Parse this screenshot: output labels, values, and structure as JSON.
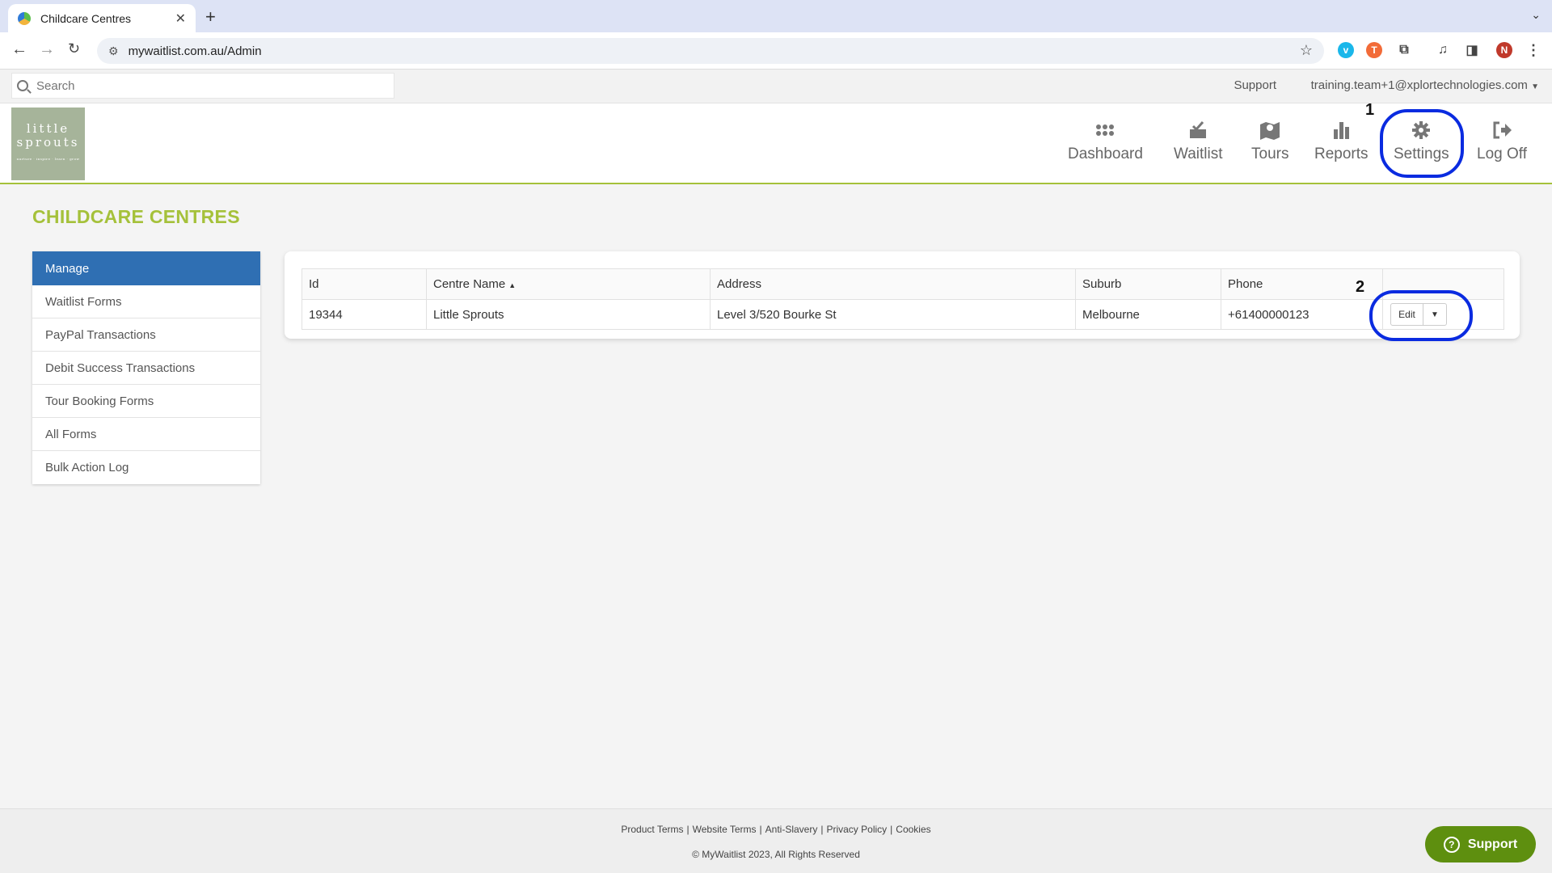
{
  "browser": {
    "tab_title": "Childcare Centres",
    "url": "mywaitlist.com.au/Admin",
    "profile_initial": "N"
  },
  "topbar": {
    "search_placeholder": "Search",
    "support_label": "Support",
    "user_email": "training.team+1@xplortechnologies.com"
  },
  "logo": {
    "line1": "little",
    "line2": "sprouts",
    "tagline": "nurture · inspire · learn · grow"
  },
  "nav": {
    "items": [
      {
        "label": "Dashboard",
        "icon": "grid-icon"
      },
      {
        "label": "Waitlist",
        "icon": "inbox-check-icon"
      },
      {
        "label": "Tours",
        "icon": "map-pin-icon"
      },
      {
        "label": "Reports",
        "icon": "bar-chart-icon"
      },
      {
        "label": "Settings",
        "icon": "gear-icon"
      },
      {
        "label": "Log Off",
        "icon": "logout-icon"
      }
    ]
  },
  "annotations": {
    "one": "1",
    "two": "2",
    "ring_color": "#0a2be0"
  },
  "page": {
    "title": "CHILDCARE CENTRES"
  },
  "sidebar": {
    "items": [
      {
        "label": "Manage",
        "active": true
      },
      {
        "label": "Waitlist Forms"
      },
      {
        "label": "PayPal Transactions"
      },
      {
        "label": "Debit Success Transactions"
      },
      {
        "label": "Tour Booking Forms"
      },
      {
        "label": "All Forms"
      },
      {
        "label": "Bulk Action Log"
      }
    ]
  },
  "table": {
    "headers": [
      "Id",
      "Centre Name",
      "Address",
      "Suburb",
      "Phone",
      ""
    ],
    "sort_indicator": "▲",
    "rows": [
      {
        "id": "19344",
        "name": "Little Sprouts",
        "address": "Level 3/520 Bourke St",
        "suburb": "Melbourne",
        "phone": "+61400000123",
        "action": "Edit"
      }
    ]
  },
  "footer": {
    "links": [
      "Product Terms",
      "Website Terms",
      "Anti-Slavery",
      "Privacy Policy",
      "Cookies"
    ],
    "separator": "|",
    "copyright": "© MyWaitlist 2023, All Rights Reserved"
  },
  "support_fab": {
    "label": "Support"
  },
  "colors": {
    "accent_green": "#a5c13a",
    "active_blue": "#2f6fb3",
    "fab_green": "#5e8f0f"
  }
}
